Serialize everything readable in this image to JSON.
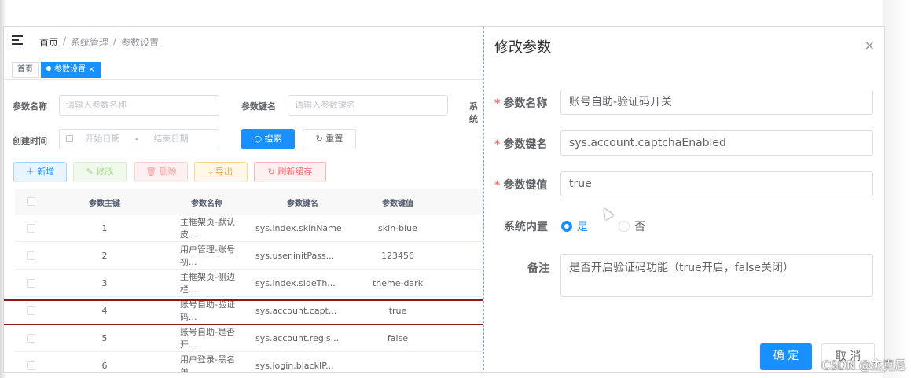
{
  "breadcrumb": {
    "home": "首页",
    "sep": "/",
    "system": "系统管理",
    "current": "参数设置"
  },
  "tags": {
    "home": "首页",
    "active": "参数设置",
    "close": "×"
  },
  "search": {
    "name_label": "参数名称",
    "name_placeholder": "请输入参数名称",
    "key_label": "参数键名",
    "key_placeholder": "请输入参数键名",
    "builtin_label": "系统",
    "date_label": "创建时间",
    "date_start": "开始日期",
    "date_sep": "-",
    "date_end": "结束日期",
    "search_btn": "搜索",
    "reset_btn": "重置"
  },
  "toolbar": {
    "add": "新增",
    "edit": "修改",
    "delete": "删除",
    "export": "导出",
    "refresh": "刷新缓存"
  },
  "table": {
    "headers": [
      "参数主键",
      "参数名称",
      "参数键名",
      "参数键值"
    ],
    "rows": [
      [
        "1",
        "主框架页-默认皮...",
        "sys.index.skinName",
        "skin-blue"
      ],
      [
        "2",
        "用户管理-账号初...",
        "sys.user.initPass...",
        "123456"
      ],
      [
        "3",
        "主框架页-侧边栏...",
        "sys.index.sideTh...",
        "theme-dark"
      ],
      [
        "4",
        "账号自助-验证码...",
        "sys.account.capt...",
        "true"
      ],
      [
        "5",
        "账号自助-是否开...",
        "sys.account.regis...",
        "false"
      ],
      [
        "6",
        "用户登录-黑名单...",
        "sys.login.blackIP...",
        ""
      ]
    ]
  },
  "dialog": {
    "title": "修改参数",
    "close": "×",
    "name_label": "参数名称",
    "name_value": "账号自助-验证码开关",
    "key_label": "参数键名",
    "key_value": "sys.account.captchaEnabled",
    "value_label": "参数键值",
    "value_value": "true",
    "builtin_label": "系统内置",
    "yes": "是",
    "no": "否",
    "remark_label": "备注",
    "remark_value": "是否开启验证码功能（true开启，false关闭）",
    "confirm": "确 定",
    "cancel": "取 消",
    "required_mark": "*"
  },
  "watermark": "CSDN @杰克尼",
  "colors": {
    "primary": "#1890ff",
    "highlight_border": "#8b1b1b",
    "danger": "#f56c6c"
  }
}
